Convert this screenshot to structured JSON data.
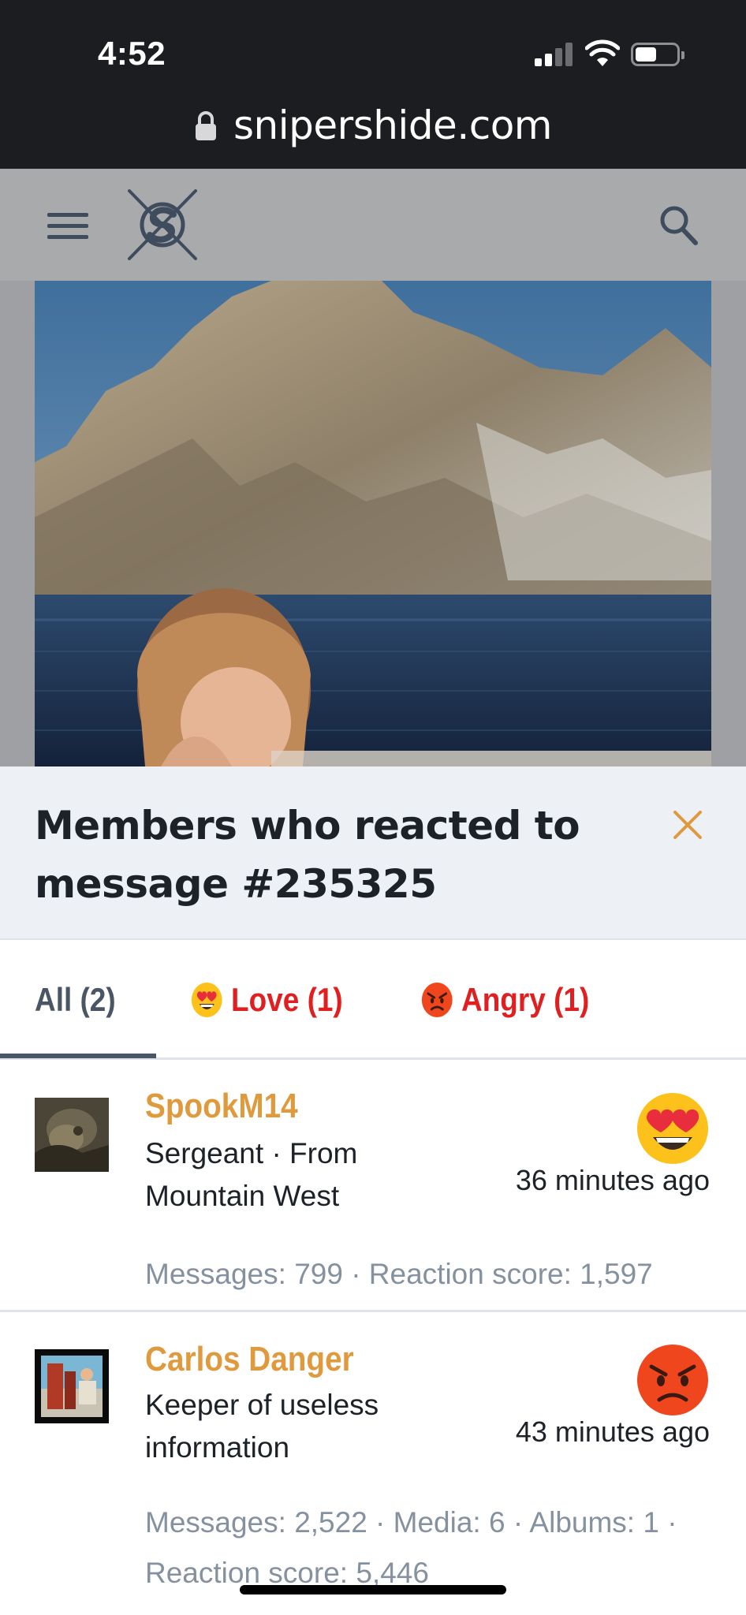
{
  "status_bar": {
    "time": "4:52",
    "signal_bars": 2,
    "battery_level": 0.4
  },
  "browser": {
    "url": "snipershide.com"
  },
  "site_header": {
    "menu_icon": "hamburger-icon",
    "logo_icon": "crosshair-s-logo",
    "search_icon": "search-icon"
  },
  "overlay": {
    "title": "Members who reacted to message #235325",
    "close_icon": "close-icon",
    "accent_color": "#e09a3e"
  },
  "tabs": [
    {
      "label": "All (2)",
      "emoji": null,
      "active": true
    },
    {
      "label": "Love (1)",
      "emoji": "heart-eyes-emoji",
      "active": false
    },
    {
      "label": "Angry (1)",
      "emoji": "angry-face-emoji",
      "active": false
    }
  ],
  "members": [
    {
      "name": "SpookM14",
      "title": "Sergeant · From Mountain West",
      "stats": "Messages: 799 · Reaction score: 1,597",
      "time_ago": "36 minutes ago",
      "reaction": "heart-eyes-emoji"
    },
    {
      "name": "Carlos Danger",
      "title": "Keeper of useless information",
      "stats": "Messages: 2,522 · Media: 6 · Albums: 1 · Reaction score: 5,446",
      "time_ago": "43 minutes ago",
      "reaction": "angry-face-emoji"
    }
  ]
}
